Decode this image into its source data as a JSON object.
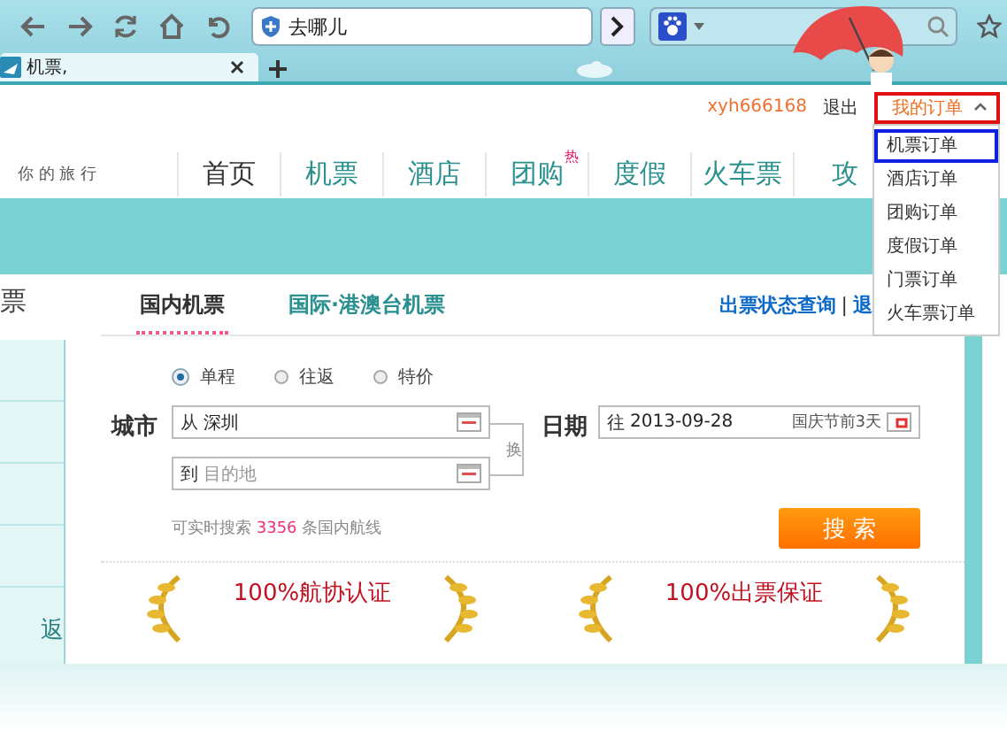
{
  "browser": {
    "address_text": "去哪儿",
    "tab_title": "机票,"
  },
  "header": {
    "username": "xyh666168",
    "logout": "退出",
    "my_orders": {
      "label": "我的订单",
      "expanded": true
    },
    "dropdown": [
      {
        "label": "机票订单",
        "selected": true
      },
      {
        "label": "酒店订单",
        "selected": false
      },
      {
        "label": "团购订单",
        "selected": false
      },
      {
        "label": "度假订单",
        "selected": false
      },
      {
        "label": "门票订单",
        "selected": false
      },
      {
        "label": "火车票订单",
        "selected": false
      }
    ]
  },
  "nav": {
    "tagline": "你 的 旅 行",
    "items": [
      {
        "label": "首页",
        "selected": true
      },
      {
        "label": "机票",
        "selected": false
      },
      {
        "label": "酒店",
        "selected": false
      },
      {
        "label": "团购",
        "selected": false,
        "badge": "热"
      },
      {
        "label": "度假",
        "selected": false
      },
      {
        "label": "火车票",
        "selected": false
      },
      {
        "label": "攻",
        "selected": false
      }
    ]
  },
  "sidebar": {
    "title": "票",
    "bottom_text": "返"
  },
  "tabs": [
    {
      "label": "国内机票",
      "selected": true
    },
    {
      "label": "国际·港澳台机票",
      "selected": false
    }
  ],
  "links": {
    "items": [
      "出票状态查询",
      "退"
    ],
    "separator": "|"
  },
  "trip_types": [
    {
      "label": "单程",
      "selected": true
    },
    {
      "label": "往返",
      "selected": false
    },
    {
      "label": "特价",
      "selected": false
    }
  ],
  "city": {
    "label": "城市",
    "from": {
      "prefix": "从",
      "value": "深圳"
    },
    "to": {
      "prefix": "到",
      "placeholder": "目的地"
    },
    "swap": "换"
  },
  "date": {
    "label": "日期",
    "prefix": "往",
    "value": "2013-09-28",
    "note": "国庆节前3天"
  },
  "route_count": {
    "prefix": "可实时搜索",
    "count": "3356",
    "suffix": "条国内航线"
  },
  "search_button": "搜 索",
  "guarantees": [
    "100%航协认证",
    "100%出票保证"
  ]
}
